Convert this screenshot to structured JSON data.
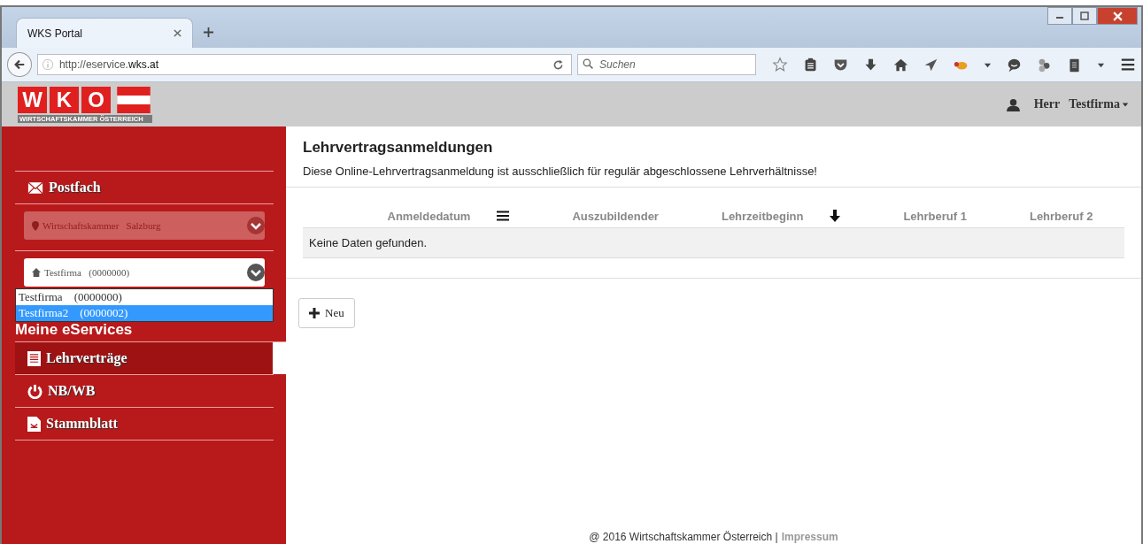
{
  "browser": {
    "tab": {
      "title": "WKS Portal",
      "selected": true
    },
    "url_prefix": "http://eservice.",
    "url_domain": "wks.at",
    "search": {
      "placeholder": "Suchen"
    }
  },
  "header": {
    "logo_letters": [
      "W",
      "K",
      "O"
    ],
    "logo_caption": "WIRTSCHAFTSKAMMER ÖSTERREICH",
    "salutation": "Herr",
    "user": "Testfirma"
  },
  "sidebar": {
    "postfach": "Postfach",
    "chamber_select": {
      "value": "Wirtschaftskammer   Salzburg",
      "disabled": true
    },
    "company_select": {
      "value": "Testfirma   (0000000)",
      "disabled": false,
      "expanded": true,
      "options": [
        {
          "label": "Testfirma    (0000000)",
          "selected": false
        },
        {
          "label": "Testfirma2    (0000002)",
          "selected": true
        }
      ]
    },
    "section_title": "Meine eServices",
    "items": [
      {
        "label": "Lehrverträge",
        "kind": "list",
        "selected": true
      },
      {
        "label": "NB/WB",
        "kind": "power",
        "selected": false
      },
      {
        "label": "Stammblatt",
        "kind": "document",
        "selected": false
      }
    ]
  },
  "main": {
    "title": "Lehrvertragsanmeldungen",
    "notice": "Diese Online-Lehrvertragsanmeldung ist ausschließlich für regulär abgeschlossene Lehrverhältnisse!",
    "table": {
      "columns": [
        {
          "label": "Anmeldedatum",
          "kind": "menu"
        },
        {
          "label": "Auszubildender",
          "kind": "plain"
        },
        {
          "label": "Lehrzeitbeginn",
          "kind": "sort"
        },
        {
          "label": "Lehrberuf 1",
          "kind": "plain"
        },
        {
          "label": "Lehrberuf 2",
          "kind": "plain"
        }
      ],
      "empty_message": "Keine Daten gefunden."
    },
    "new_button": "Neu"
  },
  "footer": {
    "copyright": "@ 2016 Wirtschaftskammer Österreich |",
    "link": "Impressum"
  }
}
